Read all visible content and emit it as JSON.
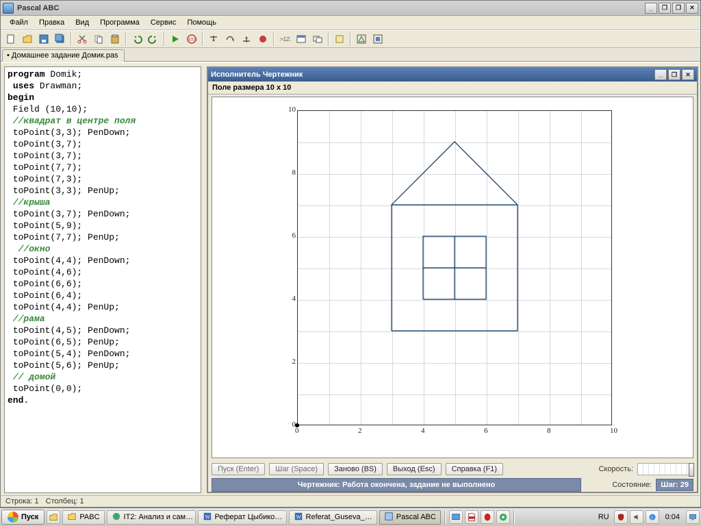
{
  "app": {
    "title": "Pascal ABC"
  },
  "window_controls": {
    "min": "_",
    "max": "❐",
    "restore": "❐",
    "close": "✕"
  },
  "menu": [
    "Файл",
    "Правка",
    "Вид",
    "Программа",
    "Сервис",
    "Помощь"
  ],
  "tab": {
    "label": "• Домашнее задание Домик.pas"
  },
  "code": {
    "lines": [
      {
        "indent": 0,
        "tokens": [
          {
            "t": "kw",
            "v": "program"
          },
          {
            "t": "sym",
            "v": " Domik;"
          }
        ]
      },
      {
        "indent": 1,
        "tokens": [
          {
            "t": "kw",
            "v": "uses"
          },
          {
            "t": "sym",
            "v": " Drawman;"
          }
        ]
      },
      {
        "indent": 0,
        "tokens": [
          {
            "t": "kw",
            "v": "begin"
          }
        ]
      },
      {
        "indent": 1,
        "tokens": [
          {
            "t": "sym",
            "v": "Field (10,10);"
          }
        ]
      },
      {
        "indent": 1,
        "tokens": [
          {
            "t": "cm",
            "v": "//квадрат в центре поля"
          }
        ]
      },
      {
        "indent": 1,
        "tokens": [
          {
            "t": "sym",
            "v": "toPoint(3,3); PenDown;"
          }
        ]
      },
      {
        "indent": 1,
        "tokens": [
          {
            "t": "sym",
            "v": "toPoint(3,7);"
          }
        ]
      },
      {
        "indent": 1,
        "tokens": [
          {
            "t": "sym",
            "v": "toPoint(3,7);"
          }
        ]
      },
      {
        "indent": 1,
        "tokens": [
          {
            "t": "sym",
            "v": "toPoint(7,7);"
          }
        ]
      },
      {
        "indent": 1,
        "tokens": [
          {
            "t": "sym",
            "v": "toPoint(7,3);"
          }
        ]
      },
      {
        "indent": 1,
        "tokens": [
          {
            "t": "sym",
            "v": "toPoint(3,3); PenUp;"
          }
        ]
      },
      {
        "indent": 1,
        "tokens": [
          {
            "t": "cm",
            "v": "//крыша"
          }
        ]
      },
      {
        "indent": 1,
        "tokens": [
          {
            "t": "sym",
            "v": "toPoint(3,7); PenDown;"
          }
        ]
      },
      {
        "indent": 1,
        "tokens": [
          {
            "t": "sym",
            "v": "toPoint(5,9);"
          }
        ]
      },
      {
        "indent": 1,
        "tokens": [
          {
            "t": "sym",
            "v": "toPoint(7,7); PenUp;"
          }
        ]
      },
      {
        "indent": 2,
        "tokens": [
          {
            "t": "cm",
            "v": "//окно"
          }
        ]
      },
      {
        "indent": 1,
        "tokens": [
          {
            "t": "sym",
            "v": "toPoint(4,4); PenDown;"
          }
        ]
      },
      {
        "indent": 1,
        "tokens": [
          {
            "t": "sym",
            "v": "toPoint(4,6);"
          }
        ]
      },
      {
        "indent": 1,
        "tokens": [
          {
            "t": "sym",
            "v": "toPoint(6,6);"
          }
        ]
      },
      {
        "indent": 1,
        "tokens": [
          {
            "t": "sym",
            "v": "toPoint(6,4);"
          }
        ]
      },
      {
        "indent": 1,
        "tokens": [
          {
            "t": "sym",
            "v": "toPoint(4,4); PenUp;"
          }
        ]
      },
      {
        "indent": 1,
        "tokens": [
          {
            "t": "cm",
            "v": "//рама"
          }
        ]
      },
      {
        "indent": 1,
        "tokens": [
          {
            "t": "sym",
            "v": "toPoint(4,5); PenDown;"
          }
        ]
      },
      {
        "indent": 1,
        "tokens": [
          {
            "t": "sym",
            "v": "toPoint(6,5); PenUp;"
          }
        ]
      },
      {
        "indent": 1,
        "tokens": [
          {
            "t": "sym",
            "v": "toPoint(5,4); PenDown;"
          }
        ]
      },
      {
        "indent": 1,
        "tokens": [
          {
            "t": "sym",
            "v": "toPoint(5,6); PenUp;"
          }
        ]
      },
      {
        "indent": 1,
        "tokens": [
          {
            "t": "cm",
            "v": "// домой"
          }
        ]
      },
      {
        "indent": 1,
        "tokens": [
          {
            "t": "sym",
            "v": "toPoint(0,0);"
          }
        ]
      },
      {
        "indent": 0,
        "tokens": [
          {
            "t": "kw",
            "v": "end"
          },
          {
            "t": "sym",
            "v": "."
          }
        ]
      }
    ]
  },
  "drawman": {
    "window_title": "Исполнитель Чертежник",
    "subtitle": "Поле размера 10 x 10",
    "buttons": {
      "run": "Пуск (Enter)",
      "step": "Шаг (Space)",
      "reset": "Заново (BS)",
      "exit": "Выход (Esc)",
      "help": "Справка (F1)"
    },
    "labels": {
      "speed": "Скорость:",
      "state": "Состояние:"
    },
    "status_msg": "Чертежник: Работа окончена, задание не выполнено",
    "step_badge": "Шаг: 29",
    "grid": {
      "size": 10,
      "ticks": [
        0,
        2,
        4,
        6,
        8,
        10
      ]
    }
  },
  "statusbar": {
    "line": "Строка: 1",
    "col": "Столбец: 1"
  },
  "taskbar": {
    "start": "Пуск",
    "items": [
      {
        "label": "PABC",
        "icon": "folder",
        "active": false
      },
      {
        "label": "IT2: Анализ и сам…",
        "icon": "globe",
        "active": false
      },
      {
        "label": "Реферат Цыбико…",
        "icon": "word",
        "active": false
      },
      {
        "label": "Referat_Guseva_…",
        "icon": "word",
        "active": false
      },
      {
        "label": "Pascal ABC",
        "icon": "app",
        "active": true
      }
    ],
    "lang": "RU",
    "clock": "0:04"
  },
  "chart_data": {
    "type": "line",
    "title": "Поле размера 10 x 10",
    "xlabel": "",
    "ylabel": "",
    "xlim": [
      0,
      10
    ],
    "ylim": [
      0,
      10
    ],
    "series": [
      {
        "name": "square",
        "points": [
          [
            3,
            3
          ],
          [
            3,
            7
          ],
          [
            7,
            7
          ],
          [
            7,
            3
          ],
          [
            3,
            3
          ]
        ]
      },
      {
        "name": "roof",
        "points": [
          [
            3,
            7
          ],
          [
            5,
            9
          ],
          [
            7,
            7
          ]
        ]
      },
      {
        "name": "window",
        "points": [
          [
            4,
            4
          ],
          [
            4,
            6
          ],
          [
            6,
            6
          ],
          [
            6,
            4
          ],
          [
            4,
            4
          ]
        ]
      },
      {
        "name": "frame-h",
        "points": [
          [
            4,
            5
          ],
          [
            6,
            5
          ]
        ]
      },
      {
        "name": "frame-v",
        "points": [
          [
            5,
            4
          ],
          [
            5,
            6
          ]
        ]
      }
    ],
    "turtle_end": [
      0,
      0
    ]
  }
}
